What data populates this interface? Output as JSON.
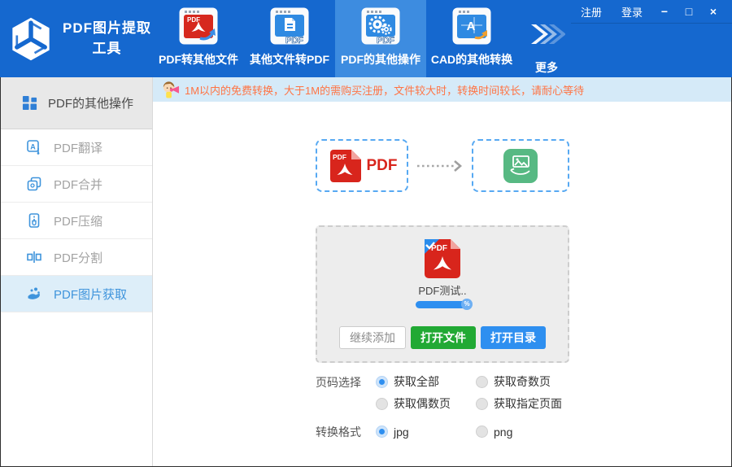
{
  "app": {
    "title_line1": "PDF图片提取",
    "title_line2": "工具"
  },
  "titlebar": {
    "register": "注册",
    "login": "登录",
    "minimize": "−",
    "maximize": "□",
    "close": "×"
  },
  "tabs": [
    {
      "label": "PDF转其他文件",
      "icon": "pdf-to-other-icon",
      "active": false
    },
    {
      "label": "其他文件转PDF",
      "icon": "other-to-pdf-icon",
      "active": false
    },
    {
      "label": "PDF的其他操作",
      "icon": "pdf-gears-icon",
      "active": true
    },
    {
      "label": "CAD的其他转换",
      "icon": "cad-convert-icon",
      "active": false
    },
    {
      "label": "更多",
      "icon": "more-chevrons-icon",
      "active": false
    }
  ],
  "sidebar": {
    "header": {
      "label": "PDF的其他操作",
      "icon": "grid-icon"
    },
    "items": [
      {
        "label": "PDF翻译",
        "icon": "translate-icon",
        "active": false
      },
      {
        "label": "PDF合并",
        "icon": "merge-icon",
        "active": false
      },
      {
        "label": "PDF压缩",
        "icon": "compress-icon",
        "active": false
      },
      {
        "label": "PDF分割",
        "icon": "split-icon",
        "active": false
      },
      {
        "label": "PDF图片获取",
        "icon": "extract-image-icon",
        "active": true
      }
    ]
  },
  "notice": {
    "icon": "mascot-megaphone-icon",
    "text": "1M以内的免费转换，大于1M的需购买注册，文件较大时，转换时间较长，请耐心等待"
  },
  "flow": {
    "source_label": "PDF",
    "source_icon": "pdf-file-icon",
    "target_icon": "image-extract-icon",
    "arrow_icon": "dotted-arrow-icon"
  },
  "dropzone": {
    "file_icon": "pdf-file-checked-icon",
    "file_icon_label": "PDF",
    "filename": "PDF测试..",
    "progress_badge": "%",
    "buttons": [
      {
        "label": "继续添加",
        "style": "plain"
      },
      {
        "label": "打开文件",
        "style": "green"
      },
      {
        "label": "打开目录",
        "style": "blue"
      }
    ]
  },
  "options": {
    "page_select": {
      "label": "页码选择",
      "options": [
        {
          "label": "获取全部",
          "checked": true
        },
        {
          "label": "获取奇数页",
          "checked": false
        },
        {
          "label": "获取偶数页",
          "checked": false
        },
        {
          "label": "获取指定页面",
          "checked": false
        }
      ]
    },
    "format": {
      "label": "转换格式",
      "options": [
        {
          "label": "jpg",
          "checked": true
        },
        {
          "label": "png",
          "checked": false
        }
      ]
    }
  },
  "colors": {
    "c-header": "#1568cf",
    "c-header-active": "#3d8ce0",
    "c-accent": "#2e8ff0",
    "c-green": "#21a934",
    "c-red": "#d8251c",
    "c-notice-bg": "#d5eaf8",
    "c-notice-text": "#ff7444",
    "c-side-active-bg": "#ddeef9",
    "c-side-active-text": "#3f94dc",
    "c-side-header-bg": "#e8e8e8"
  }
}
